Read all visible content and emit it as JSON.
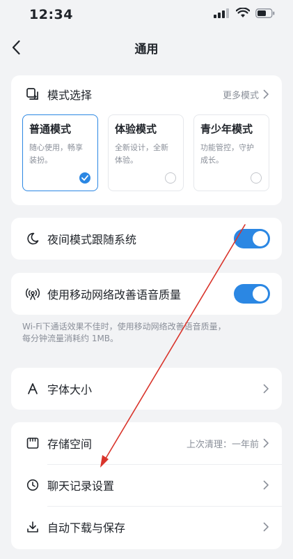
{
  "status_bar": {
    "time": "12:34"
  },
  "nav": {
    "title": "通用",
    "back_icon": "chevron-left-icon"
  },
  "mode_card": {
    "title": "模式选择",
    "more_label": "更多模式",
    "icon": "mode-switch-icon",
    "modes": [
      {
        "title": "普通模式",
        "desc_line1": "随心使用，畅享",
        "desc_line2": "装扮。",
        "selected": true
      },
      {
        "title": "体验模式",
        "desc_line1": "全新设计，全新",
        "desc_line2": "体验。",
        "selected": false
      },
      {
        "title": "青少年模式",
        "desc_line1": "功能管控，守护",
        "desc_line2": "成长。",
        "selected": false
      }
    ]
  },
  "night_mode": {
    "label": "夜间模式跟随系统",
    "icon": "moon-icon",
    "enabled": true
  },
  "mobile_voice": {
    "label": "使用移动网络改善语音质量",
    "icon": "signal-icon",
    "enabled": true,
    "hint_line1": "Wi-Fi下通话效果不佳时，使用移动网络改善语音质量，",
    "hint_line2": "每分钟流量消耗约 1MB。"
  },
  "font_size": {
    "label": "字体大小",
    "icon": "font-icon"
  },
  "storage_card": {
    "storage_label": "存储空间",
    "storage_icon": "storage-icon",
    "storage_value": "上次清理：一年前",
    "chat_label": "聊天记录设置",
    "chat_icon": "clock-icon",
    "download_label": "自动下载与保存",
    "download_icon": "download-icon"
  },
  "colors": {
    "accent": "#2b87e3",
    "background": "#f2f3f5",
    "annotation": "#d9342b"
  }
}
